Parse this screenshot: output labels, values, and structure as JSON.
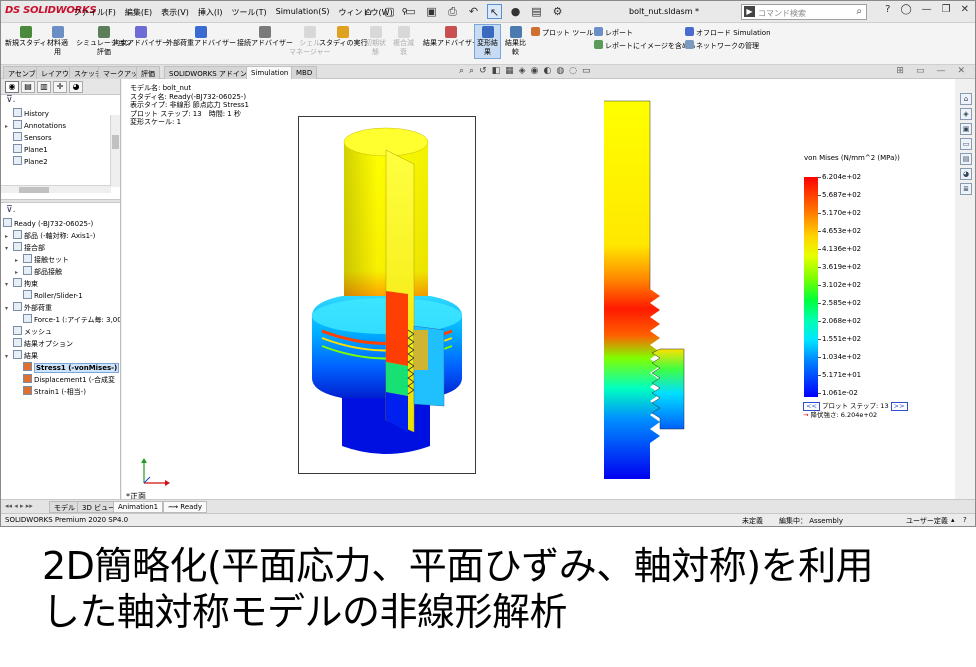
{
  "app": {
    "logo": "DS SOLIDWORKS",
    "document_title": "bolt_nut.sldasm *"
  },
  "menu": [
    "ファイル(F)",
    "編集(E)",
    "表示(V)",
    "挿入(I)",
    "ツール(T)",
    "Simulation(S)",
    "ウィンドウ(W)"
  ],
  "search": {
    "placeholder": "コマンド検索"
  },
  "ribbon": {
    "new_study": "新規スタディ",
    "material_1": "材料適",
    "material_2": "用",
    "simeval_1": "シミュレーション",
    "simeval_2": "評価",
    "fixture": "拘束アドバイザー",
    "extload": "外部荷重アドバイザー",
    "connection": "接続アドバイザー",
    "shell_1": "シェル",
    "shell_2": "マネージャー",
    "run": "スタディの実行",
    "initial_1": "初期状",
    "initial_2": "態",
    "compare_1": "複合減",
    "compare_2": "衰",
    "results_adv": "結果アドバイザー",
    "deformed_1": "変形結",
    "deformed_2": "果",
    "compare_res_1": "結果比",
    "compare_res_2": "較",
    "plot_tools": "プロット ツール",
    "report": "レポート",
    "include_image": "レポートにイメージを含める",
    "offload": "オフロード Simulation",
    "network": "ネットワークの管理"
  },
  "tabs": [
    "アセンブリ",
    "レイアウト",
    "スケッチ",
    "マークアップ",
    "評価",
    "SOLIDWORKS アドイン",
    "Simulation",
    "MBD"
  ],
  "active_tab": "Simulation",
  "feature_tree": [
    "History",
    "Annotations",
    "Sensors",
    "Plane1",
    "Plane2"
  ],
  "sim_tree": {
    "study": "Ready (-BJ732-06025-)",
    "parts": "部品 (-軸対称: Axis1-)",
    "connections": "接合部",
    "contact_set": "接触セット",
    "component_contact": "部品接触",
    "fixtures": "拘束",
    "roller": "Roller/Slider-1",
    "external_loads": "外部荷重",
    "force": "Force-1 (:アイテム毎: 3,00",
    "mesh": "メッシュ",
    "result_options": "結果オプション",
    "results": "結果",
    "stress": "Stress1 (-vonMises-)",
    "displacement": "Displacement1 (-合成変",
    "strain": "Strain1 (-相当-)"
  },
  "info": [
    "モデル名: bolt_nut",
    "スタディ名: Ready(-BJ732-06025-)",
    "表示タイプ: 非線形 節点応力 Stress1",
    "プロット ステップ: 13　時間: 1 秒",
    "変形スケール: 1"
  ],
  "legend": {
    "title": "von Mises (N/mm^2 (MPa))",
    "values": [
      "6.204e+02",
      "5.687e+02",
      "5.170e+02",
      "4.653e+02",
      "4.136e+02",
      "3.619e+02",
      "3.102e+02",
      "2.585e+02",
      "2.068e+02",
      "1.551e+02",
      "1.034e+02",
      "5.171e+01",
      "1.061e-02"
    ],
    "plot_step_label": "プロット ステップ: 13",
    "yield_label": "降伏強さ: 6.204e+02",
    "max": 620.4,
    "min": 0.01061,
    "colors": [
      "#ff0000",
      "#ff7a00",
      "#ffd400",
      "#7dff00",
      "#00ffb0",
      "#00e6ff",
      "#0000ff"
    ]
  },
  "view_label": "*正面",
  "bottom_tabs": [
    "モデル",
    "3D ビュー",
    "Animation1"
  ],
  "bottom_status": "Ready",
  "status": {
    "version": "SOLIDWORKS Premium 2020 SP4.0",
    "undefined": "未定義",
    "editing": "編集中： Assembly",
    "user_defined": "ユーザー定義"
  },
  "caption_line1": "2D簡略化(平面応力、平面ひずみ、軸対称)を利用",
  "caption_line2": "した軸対称モデルの非線形解析"
}
